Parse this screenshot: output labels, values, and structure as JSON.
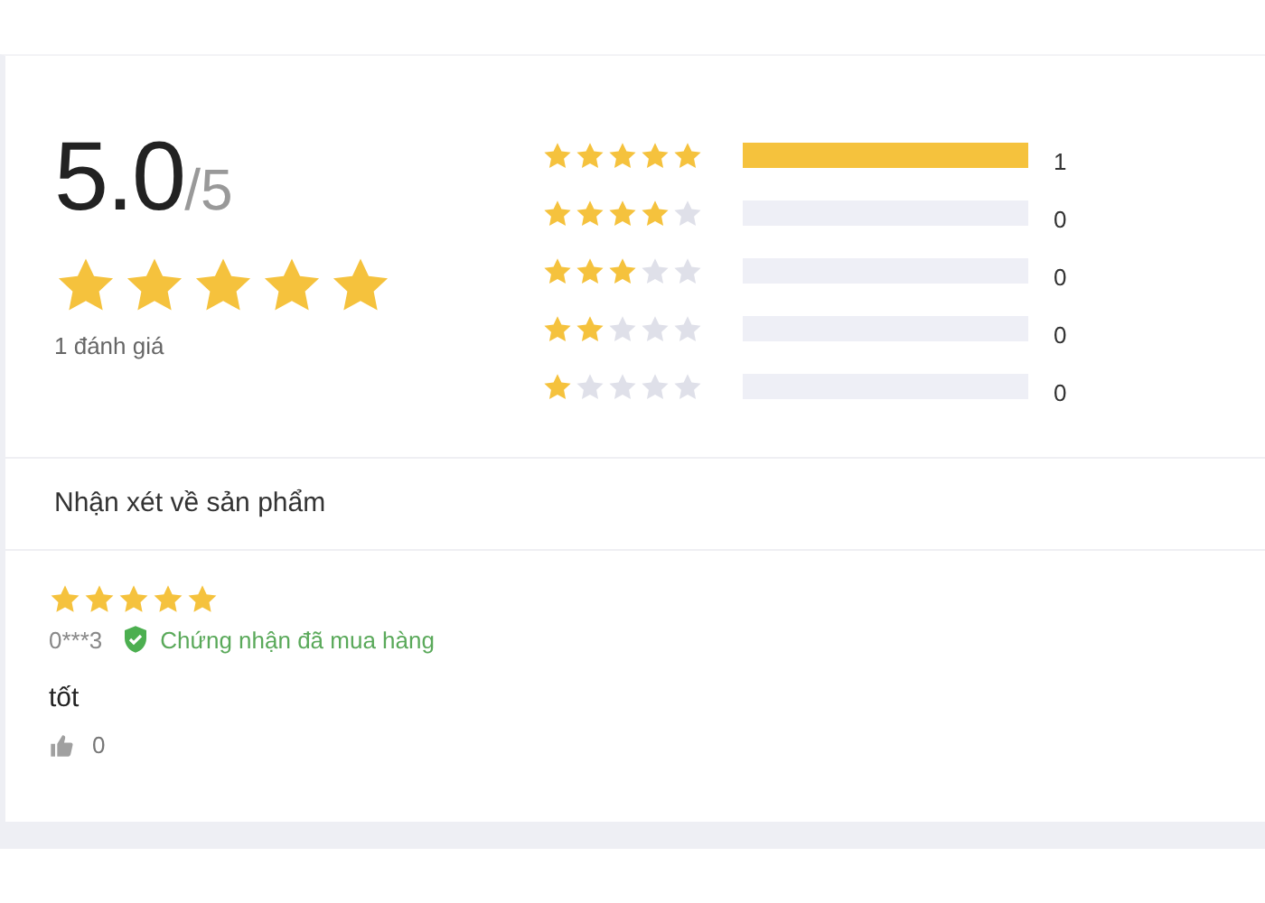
{
  "summary": {
    "score": "5.0",
    "out_of": "/5",
    "stars": 5,
    "count_label": "1 đánh giá"
  },
  "distribution": [
    {
      "stars": 5,
      "count": "1"
    },
    {
      "stars": 4,
      "count": "0"
    },
    {
      "stars": 3,
      "count": "0"
    },
    {
      "stars": 2,
      "count": "0"
    },
    {
      "stars": 1,
      "count": "0"
    }
  ],
  "reviews_heading": "Nhận xét về sản phẩm",
  "reviews": [
    {
      "stars": 5,
      "user": "0***3",
      "verified": true,
      "verified_label": "Chứng nhận đã mua hàng",
      "text": "tốt",
      "likes": "0"
    }
  ]
}
